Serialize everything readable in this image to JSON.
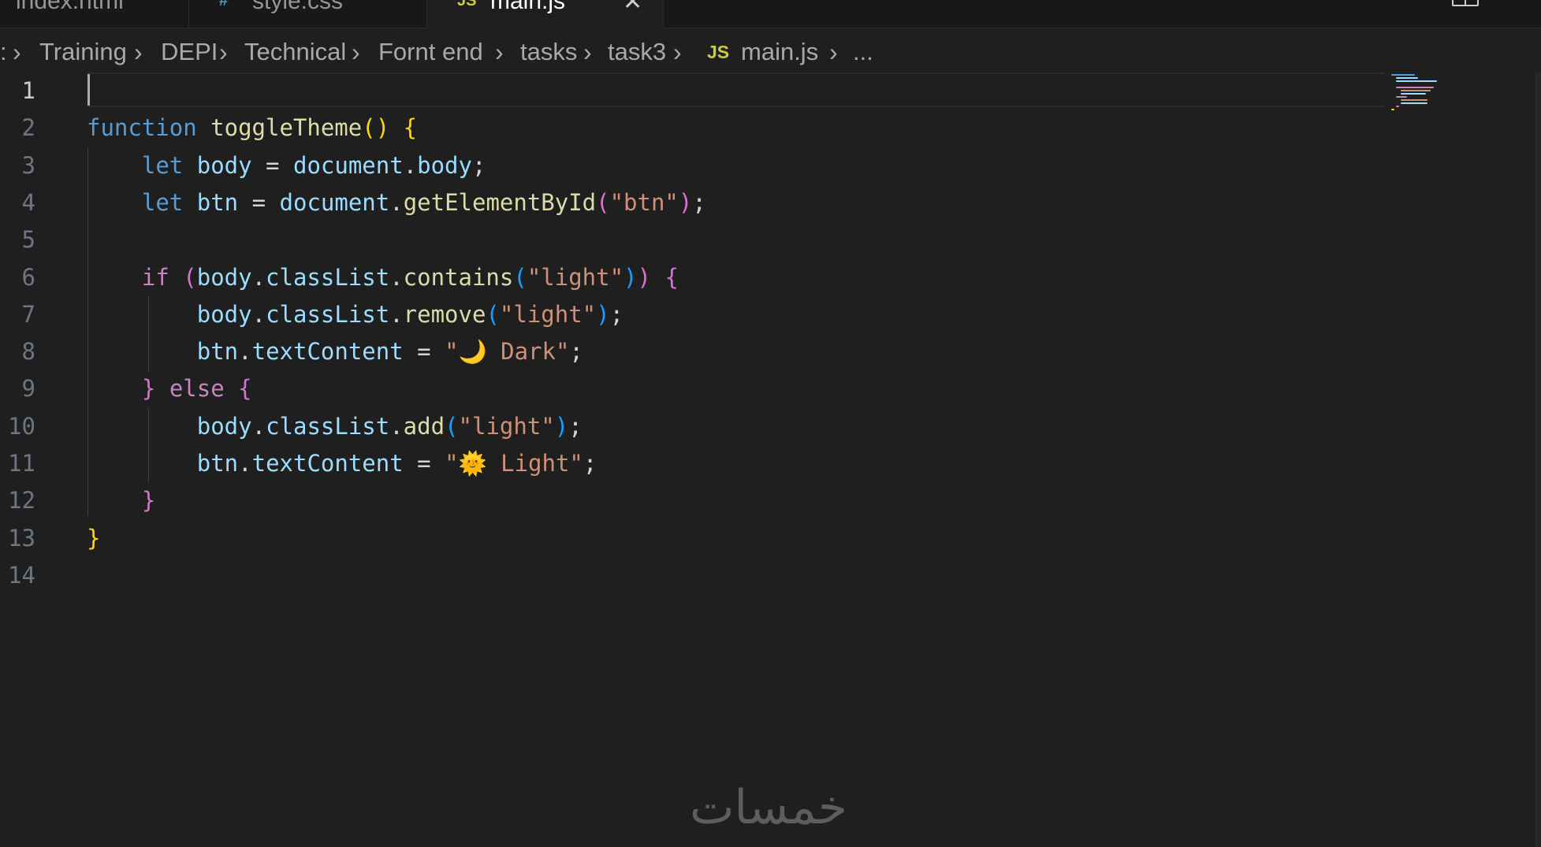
{
  "tabs": [
    {
      "label": "index.html",
      "icon": "",
      "active": false
    },
    {
      "label": "style.css",
      "icon": "#",
      "active": false
    },
    {
      "label": "main.js",
      "icon": "JS",
      "active": true,
      "close": "✕"
    }
  ],
  "breadcrumb": {
    "prefix": ":",
    "items": [
      "Training",
      "DEPI",
      "Technical",
      "Fornt end",
      "tasks",
      "task3"
    ],
    "file_icon": "JS",
    "file": "main.js",
    "more": "...",
    "separator": "›"
  },
  "editor": {
    "language": "javascript",
    "cursor_line": 1,
    "line_numbers": [
      "1",
      "2",
      "3",
      "4",
      "5",
      "6",
      "7",
      "8",
      "9",
      "10",
      "11",
      "12",
      "13",
      "14"
    ],
    "lines": [
      "",
      "function toggleTheme() {",
      "    let body = document.body;",
      "    let btn = document.getElementById(\"btn\");",
      "",
      "    if (body.classList.contains(\"light\")) {",
      "        body.classList.remove(\"light\");",
      "        btn.textContent = \"🌙 Dark\";",
      "    } else {",
      "        body.classList.add(\"light\");",
      "        btn.textContent = \"🌞 Light\";",
      "    }",
      "}",
      ""
    ]
  },
  "colors": {
    "keyword": "#569cd6",
    "control": "#c586c0",
    "function": "#dcdcaa",
    "variable": "#9cdcfe",
    "string": "#ce9178",
    "bracket_1": "#ffd700",
    "bracket_2": "#da70d6",
    "bracket_3": "#179fff"
  },
  "icons": {
    "tab_layout": "split-editor-icon",
    "moon": "moon-emoji",
    "sun": "sun-emoji"
  },
  "watermark": "خمسات"
}
